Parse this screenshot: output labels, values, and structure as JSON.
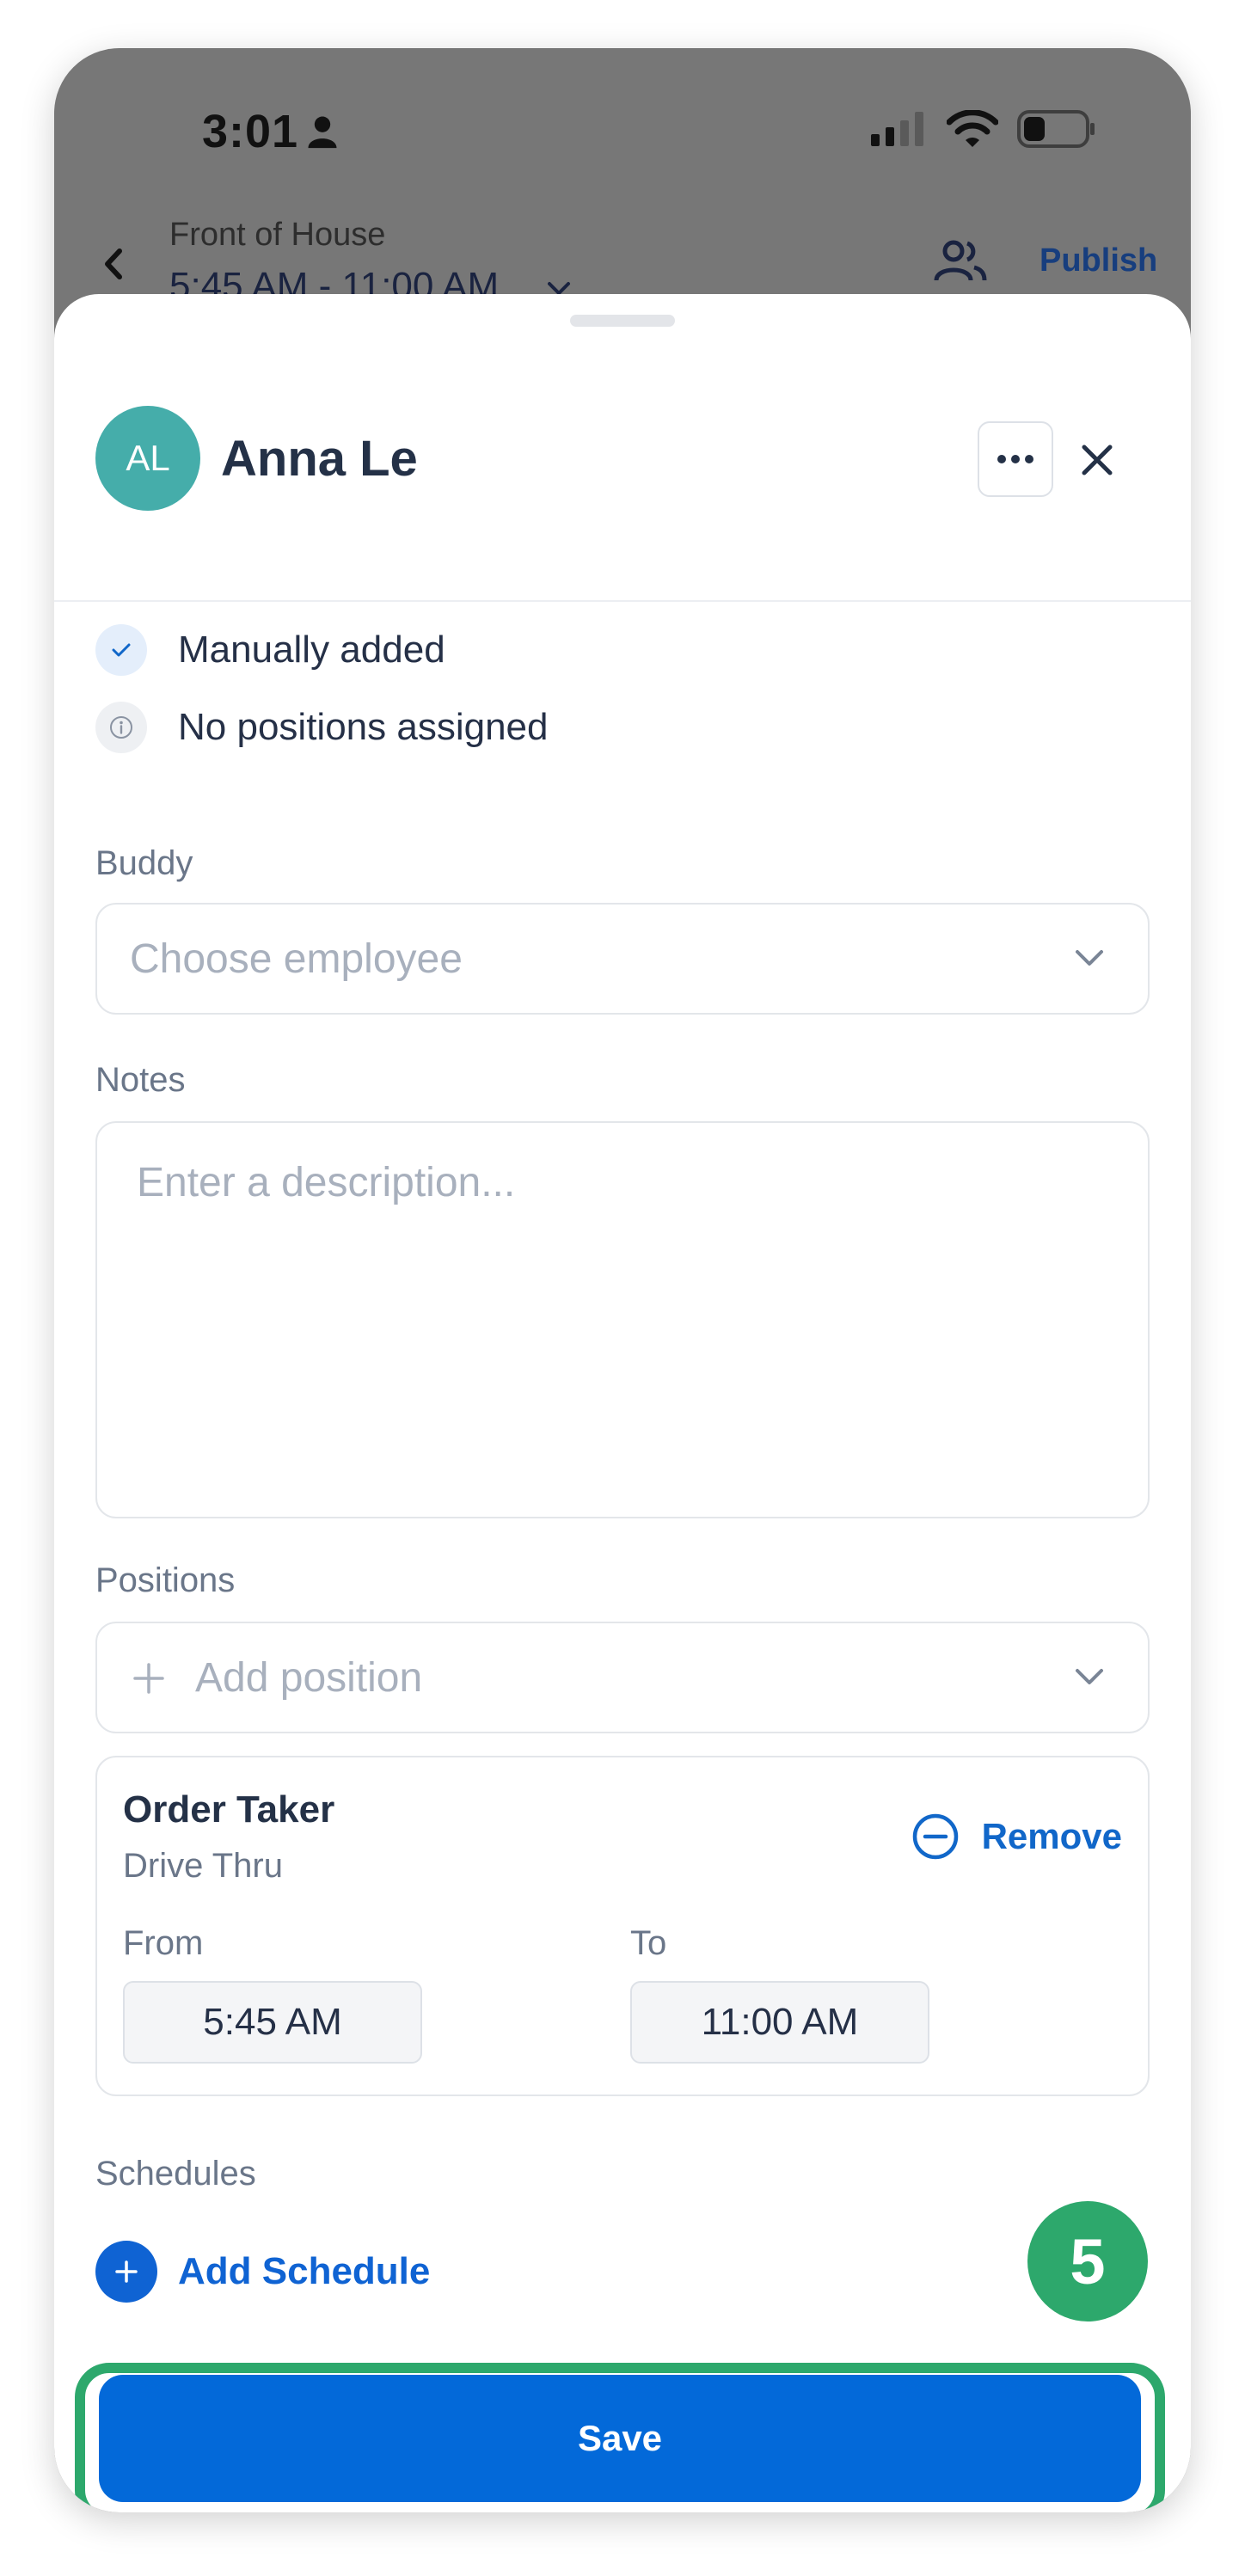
{
  "status_bar": {
    "time": "3:01"
  },
  "background_header": {
    "subtitle": "Front of House",
    "title": "5:45 AM - 11:00 AM",
    "publish_label": "Publish"
  },
  "sheet": {
    "avatar_initials": "AL",
    "employee_name": "Anna Le",
    "info": {
      "manually_added": "Manually added",
      "no_positions": "No positions assigned"
    },
    "buddy": {
      "label": "Buddy",
      "placeholder": "Choose employee"
    },
    "notes": {
      "label": "Notes",
      "placeholder": "Enter a description..."
    },
    "positions": {
      "label": "Positions",
      "add_placeholder": "Add position",
      "items": [
        {
          "title": "Order Taker",
          "subtitle": "Drive Thru",
          "remove_label": "Remove",
          "from_label": "From",
          "from_value": "5:45 AM",
          "to_label": "To",
          "to_value": "11:00 AM"
        }
      ]
    },
    "schedules": {
      "label": "Schedules",
      "add_label": "Add Schedule"
    },
    "save_label": "Save"
  },
  "step_badge": "5",
  "colors": {
    "primary": "#0369d9",
    "highlight": "#2da86c",
    "avatar": "#45adaa"
  }
}
